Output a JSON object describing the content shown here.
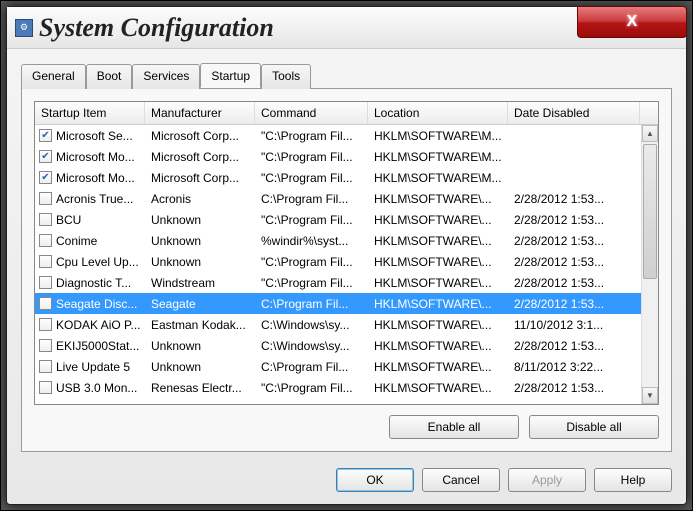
{
  "window": {
    "title": "System Configuration"
  },
  "tabs": [
    "General",
    "Boot",
    "Services",
    "Startup",
    "Tools"
  ],
  "active_tab": "Startup",
  "columns": [
    "Startup Item",
    "Manufacturer",
    "Command",
    "Location",
    "Date Disabled"
  ],
  "rows": [
    {
      "checked": true,
      "item": "Microsoft Se...",
      "mfr": "Microsoft Corp...",
      "cmd": "\"C:\\Program Fil...",
      "loc": "HKLM\\SOFTWARE\\M...",
      "date": ""
    },
    {
      "checked": true,
      "item": "Microsoft Mo...",
      "mfr": "Microsoft Corp...",
      "cmd": "\"C:\\Program Fil...",
      "loc": "HKLM\\SOFTWARE\\M...",
      "date": ""
    },
    {
      "checked": true,
      "item": "Microsoft Mo...",
      "mfr": "Microsoft Corp...",
      "cmd": "\"C:\\Program Fil...",
      "loc": "HKLM\\SOFTWARE\\M...",
      "date": ""
    },
    {
      "checked": false,
      "item": "Acronis True...",
      "mfr": "Acronis",
      "cmd": "C:\\Program Fil...",
      "loc": "HKLM\\SOFTWARE\\...",
      "date": "2/28/2012 1:53..."
    },
    {
      "checked": false,
      "item": "BCU",
      "mfr": "Unknown",
      "cmd": "\"C:\\Program Fil...",
      "loc": "HKLM\\SOFTWARE\\...",
      "date": "2/28/2012 1:53..."
    },
    {
      "checked": false,
      "item": "Conime",
      "mfr": "Unknown",
      "cmd": "%windir%\\syst...",
      "loc": "HKLM\\SOFTWARE\\...",
      "date": "2/28/2012 1:53..."
    },
    {
      "checked": false,
      "item": "Cpu Level Up...",
      "mfr": "Unknown",
      "cmd": "\"C:\\Program Fil...",
      "loc": "HKLM\\SOFTWARE\\...",
      "date": "2/28/2012 1:53..."
    },
    {
      "checked": false,
      "item": "Diagnostic T...",
      "mfr": "Windstream",
      "cmd": "\"C:\\Program Fil...",
      "loc": "HKLM\\SOFTWARE\\...",
      "date": "2/28/2012 1:53..."
    },
    {
      "checked": false,
      "item": "Seagate Disc...",
      "mfr": "Seagate",
      "cmd": "C:\\Program Fil...",
      "loc": "HKLM\\SOFTWARE\\...",
      "date": "2/28/2012 1:53...",
      "selected": true
    },
    {
      "checked": false,
      "item": "KODAK AiO P...",
      "mfr": "Eastman Kodak...",
      "cmd": "C:\\Windows\\sy...",
      "loc": "HKLM\\SOFTWARE\\...",
      "date": "11/10/2012 3:1..."
    },
    {
      "checked": false,
      "item": "EKIJ5000Stat...",
      "mfr": "Unknown",
      "cmd": "C:\\Windows\\sy...",
      "loc": "HKLM\\SOFTWARE\\...",
      "date": "2/28/2012 1:53..."
    },
    {
      "checked": false,
      "item": "Live Update 5",
      "mfr": "Unknown",
      "cmd": "C:\\Program Fil...",
      "loc": "HKLM\\SOFTWARE\\...",
      "date": "8/11/2012 3:22..."
    },
    {
      "checked": false,
      "item": "USB 3.0 Mon...",
      "mfr": "Renesas Electr...",
      "cmd": "\"C:\\Program Fil...",
      "loc": "HKLM\\SOFTWARE\\...",
      "date": "2/28/2012 1:53..."
    }
  ],
  "panel_buttons": {
    "enable_all": "Enable all",
    "disable_all": "Disable all"
  },
  "dialog_buttons": {
    "ok": "OK",
    "cancel": "Cancel",
    "apply": "Apply",
    "help": "Help"
  }
}
